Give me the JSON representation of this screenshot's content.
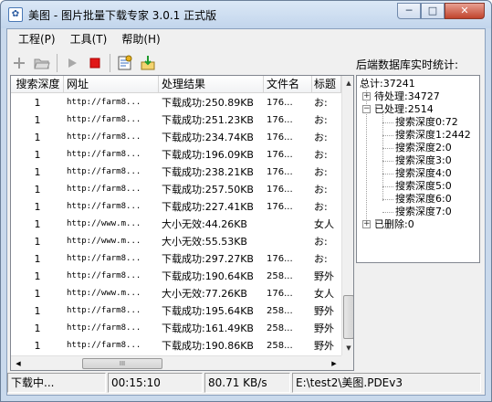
{
  "window": {
    "title": "美图 - 图片批量下载专家 3.0.1 正式版",
    "minimize_glyph": "─",
    "maximize_glyph": "□",
    "close_glyph": "✕"
  },
  "menu": [
    "工程(P)",
    "工具(T)",
    "帮助(H)"
  ],
  "toolbar_icons": [
    "add-icon",
    "open-folder-icon",
    "play-icon",
    "stop-icon",
    "settings-icon",
    "export-icon"
  ],
  "table": {
    "headers": [
      "搜索深度",
      "网址",
      "处理结果",
      "文件名",
      "标题"
    ],
    "rows": [
      {
        "depth": "1",
        "url": "http://farm8...",
        "result": "下载成功:250.89KB",
        "file": "176...",
        "title": "お:"
      },
      {
        "depth": "1",
        "url": "http://farm8...",
        "result": "下载成功:251.23KB",
        "file": "176...",
        "title": "お:"
      },
      {
        "depth": "1",
        "url": "http://farm8...",
        "result": "下载成功:234.74KB",
        "file": "176...",
        "title": "お:"
      },
      {
        "depth": "1",
        "url": "http://farm8...",
        "result": "下载成功:196.09KB",
        "file": "176...",
        "title": "お:"
      },
      {
        "depth": "1",
        "url": "http://farm8...",
        "result": "下载成功:238.21KB",
        "file": "176...",
        "title": "お:"
      },
      {
        "depth": "1",
        "url": "http://farm8...",
        "result": "下载成功:257.50KB",
        "file": "176...",
        "title": "お:"
      },
      {
        "depth": "1",
        "url": "http://farm8...",
        "result": "下载成功:227.41KB",
        "file": "176...",
        "title": "お:"
      },
      {
        "depth": "1",
        "url": "http://www.m...",
        "result": "大小无效:44.26KB",
        "file": "",
        "title": "女人"
      },
      {
        "depth": "1",
        "url": "http://www.m...",
        "result": "大小无效:55.53KB",
        "file": "",
        "title": "お:"
      },
      {
        "depth": "1",
        "url": "http://farm8...",
        "result": "下载成功:297.27KB",
        "file": "176...",
        "title": "お:"
      },
      {
        "depth": "1",
        "url": "http://farm8...",
        "result": "下载成功:190.64KB",
        "file": "258...",
        "title": "野外"
      },
      {
        "depth": "1",
        "url": "http://www.m...",
        "result": "大小无效:77.26KB",
        "file": "176...",
        "title": "女人"
      },
      {
        "depth": "1",
        "url": "http://farm8...",
        "result": "下载成功:195.64KB",
        "file": "258...",
        "title": "野外"
      },
      {
        "depth": "1",
        "url": "http://farm8...",
        "result": "下载成功:161.49KB",
        "file": "258...",
        "title": "野外"
      },
      {
        "depth": "1",
        "url": "http://farm8...",
        "result": "下载成功:190.86KB",
        "file": "258...",
        "title": "野外"
      }
    ],
    "vscroll": {
      "up": "▲",
      "down": "▼"
    },
    "hscroll": {
      "left": "◀",
      "right": "▶",
      "thumb": "III"
    }
  },
  "stats": {
    "label": "后端数据库实时统计:",
    "total": "总计:37241",
    "pending": "待处理:34727",
    "processed": "已处理:2514",
    "depths": [
      "搜索深度0:72",
      "搜索深度1:2442",
      "搜索深度2:0",
      "搜索深度3:0",
      "搜索深度4:0",
      "搜索深度5:0",
      "搜索深度6:0",
      "搜索深度7:0"
    ],
    "deleted": "已删除:0",
    "expander_plus": "+",
    "expander_minus": "−"
  },
  "status": {
    "state": "下载中...",
    "elapsed": "00:15:10",
    "speed": "80.71 KB/s",
    "path": "E:\\test2\\美图.PDEv3"
  }
}
